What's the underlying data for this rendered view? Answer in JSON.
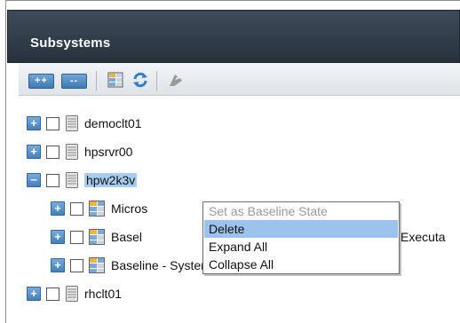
{
  "panel": {
    "title": "Subsystems"
  },
  "toolbar": {
    "expand_all_label": "++",
    "collapse_all_label": "--",
    "icons": [
      "expand-all",
      "collapse-all",
      "properties",
      "refresh",
      "baseline-disabled"
    ]
  },
  "tree": {
    "items": [
      {
        "label": "democlt01",
        "expanded": false,
        "type": "server"
      },
      {
        "label": "hpsrvr00",
        "expanded": false,
        "type": "server"
      },
      {
        "label": "hpw2k3v",
        "expanded": true,
        "type": "server",
        "selected": true
      },
      {
        "label": "Micros",
        "expanded": false,
        "type": "group"
      },
      {
        "label": "Basel",
        "trailing": "Executa",
        "expanded": false,
        "type": "group"
      },
      {
        "label": "Baseline - System Services and Depend",
        "expanded": false,
        "type": "group"
      },
      {
        "label": "rhclt01",
        "expanded": false,
        "type": "server"
      }
    ]
  },
  "context_menu": {
    "items": [
      {
        "label": "Set as Baseline State",
        "enabled": false
      },
      {
        "label": "Delete",
        "enabled": true,
        "highlighted": true
      },
      {
        "label": "Expand All",
        "enabled": true
      },
      {
        "label": "Collapse All",
        "enabled": true
      }
    ]
  },
  "colors": {
    "titlebar": "#323c48",
    "accent": "#4a85c0",
    "selection": "#a9cdf2",
    "menu_highlight": "#9bc3ee"
  }
}
